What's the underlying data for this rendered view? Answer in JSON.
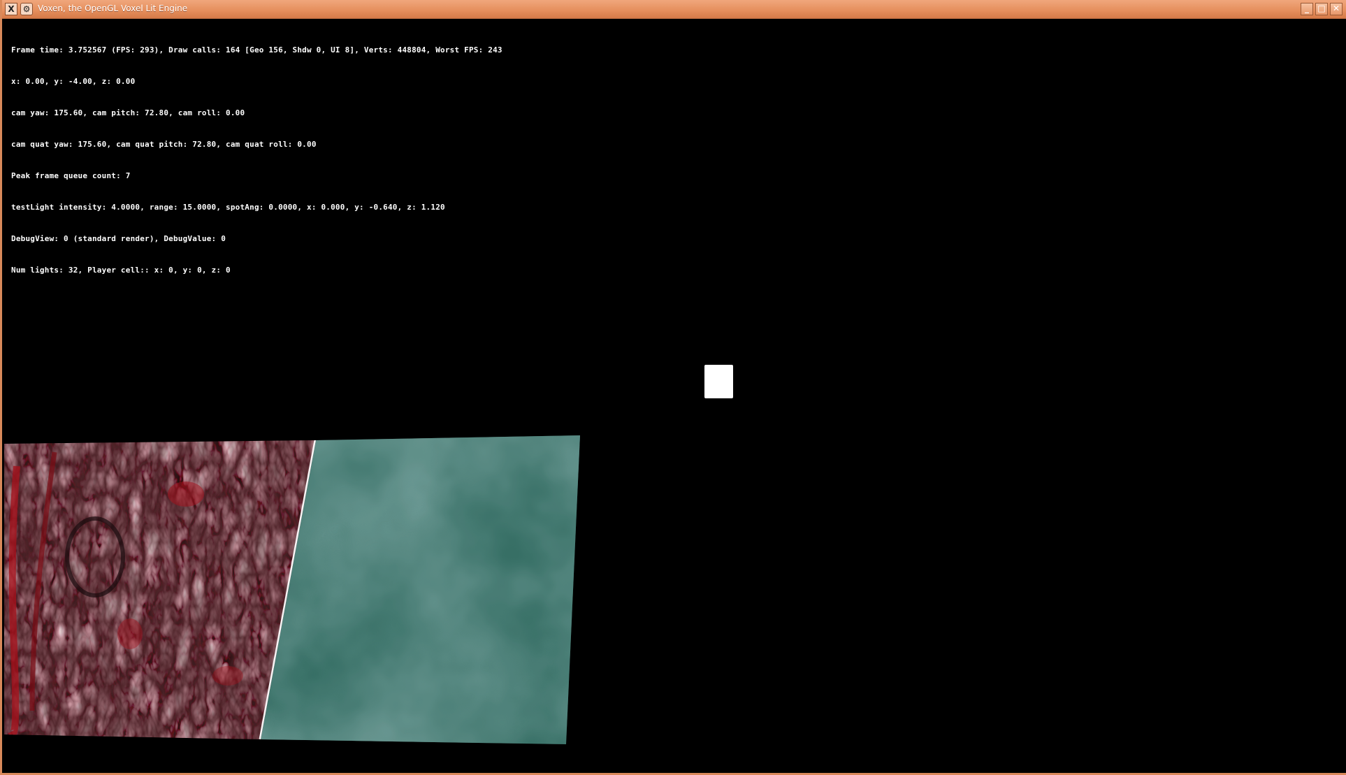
{
  "window": {
    "title": "Voxen, the OpenGL Voxel Lit Engine",
    "app_icon": "x-app-icon",
    "menu_icon": "gear-icon",
    "controls": {
      "minimize_label": "_",
      "maximize_label": "□",
      "close_label": "✕"
    }
  },
  "hud": {
    "lines": [
      "Frame time: 3.752567 (FPS: 293), Draw calls: 164 [Geo 156, Shdw 0, UI 8], Verts: 448804, Worst FPS: 243",
      "x: 0.00, y: -4.00, z: 0.00",
      "cam yaw: 175.60, cam pitch: 72.80, cam roll: 0.00",
      "cam quat yaw: 175.60, cam quat pitch: 72.80, cam quat roll: 0.00",
      "Peak frame queue count: 7",
      "testLight intensity: 4.0000, range: 15.0000, spotAng: 0.0000, x: 0.000, y: -0.640, z: 1.120",
      "DebugView: 0 (standard render), DebugValue: 0",
      "Num lights: 32, Player cell:: x: 0, y: 0, z: 0"
    ]
  },
  "scene": {
    "colors": {
      "background": "#000000",
      "floor_tile": "#3f7f74",
      "wall_tile_base": "#3a2226",
      "wall_tile_highlight": "#f2e6ea",
      "wall_tile_red": "#a3111c"
    }
  }
}
